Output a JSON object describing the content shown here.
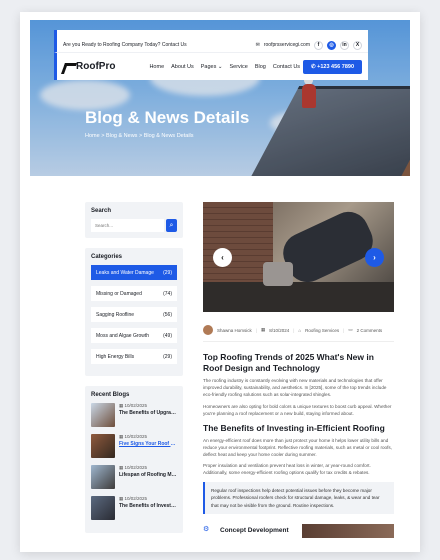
{
  "topbar": {
    "announcement": "Are you Ready to Roofing Company Today? Contact Us",
    "email": "roofprsservicegi.com",
    "social": [
      "f",
      "◎",
      "in",
      "X"
    ]
  },
  "nav": {
    "brand": "RoofPro",
    "items": [
      "Home",
      "About Us",
      "Pages ⌄",
      "Service",
      "Blog",
      "Contact Us"
    ],
    "phone": "+123 456 7890"
  },
  "hero": {
    "title": "Blog & News Details",
    "breadcrumb": "Home > Blog & News > Blog & News Details"
  },
  "sidebar": {
    "search_title": "Search",
    "search_placeholder": "Search...",
    "categories_title": "Categories",
    "categories": [
      {
        "label": "Leaks and Water Damage",
        "count": "(29)"
      },
      {
        "label": "Missing or Damaged",
        "count": "(74)"
      },
      {
        "label": "Sagging Roofline",
        "count": "(56)"
      },
      {
        "label": "Moss and Algae Growth",
        "count": "(49)"
      },
      {
        "label": "High Energy Bills",
        "count": "(29)"
      }
    ],
    "recent_title": "Recent Blogs",
    "recent": [
      {
        "date": "10/02/2025",
        "title": "The Benefits of Upgrading to an Ener..."
      },
      {
        "date": "10/02/2025",
        "title": "Five Signs Your Roof Needs Immediate At..."
      },
      {
        "date": "10/02/2025",
        "title": "Lifespan of Roofing Material What You Ne..."
      },
      {
        "date": "10/02/2025",
        "title": "The Benefits of Investing in Energy E..."
      }
    ]
  },
  "article": {
    "author": "Shawna Homsick",
    "date": "8/10/2024",
    "category": "Roofing Services",
    "comments": "2 Comments",
    "title": "Top Roofing Trends of 2025 What's New in Roof Design and Technology",
    "p1": "The roofing industry is constantly evolving with new materials and technologies that offer improved durability, sustainability, and aesthetics. In [2025], some of the top trends include eco-friendly roofing solutions such as solar-integrated shingles.",
    "p2": "Homeowners are also opting for bold colors & unique textures to boost curb appeal. Whether you're planning a roof replacement or a new build, staying informed about.",
    "h2": "The Benefits of Investing in-Efficient Roofing",
    "p3": "An energy-efficient roof does more than just protect your home it helps lower utility bills and reduce your environmental footprint. Reflective roofing materials, such as metal or cool roofs, deflect heat and keep your home cooler during summer.",
    "p4": "Proper insulation and ventilation prevent heat loss in winter, ar year-round comfort. Additionally, some energy-efficient roofing options qualify for tax credits & rebates.",
    "quote": "Regular roof inspections help detect potential issues before they become major problems. Professional roofers check for structural damage, leaks, & wear and tear that may not be visible from the ground. Routine inspections.",
    "next_title": "Concept Development"
  }
}
